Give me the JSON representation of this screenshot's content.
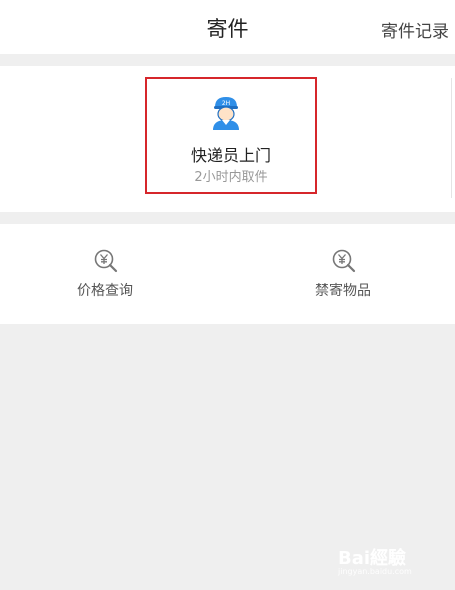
{
  "header": {
    "title": "寄件",
    "right_link": "寄件记录"
  },
  "courier": {
    "title": "快递员上门",
    "subtitle": "2小时内取件",
    "icon": "courier-avatar-icon",
    "icon_badge": "2H"
  },
  "tools": [
    {
      "label": "价格查询",
      "icon": "yuan-search-icon"
    },
    {
      "label": "禁寄物品",
      "icon": "yuan-search-icon"
    }
  ],
  "watermark": {
    "text": "Bai經驗",
    "url": "jingyan.baidu.com"
  },
  "colors": {
    "highlight_border": "#d6262b",
    "accent_blue": "#2f8fe8",
    "background": "#efefef"
  }
}
